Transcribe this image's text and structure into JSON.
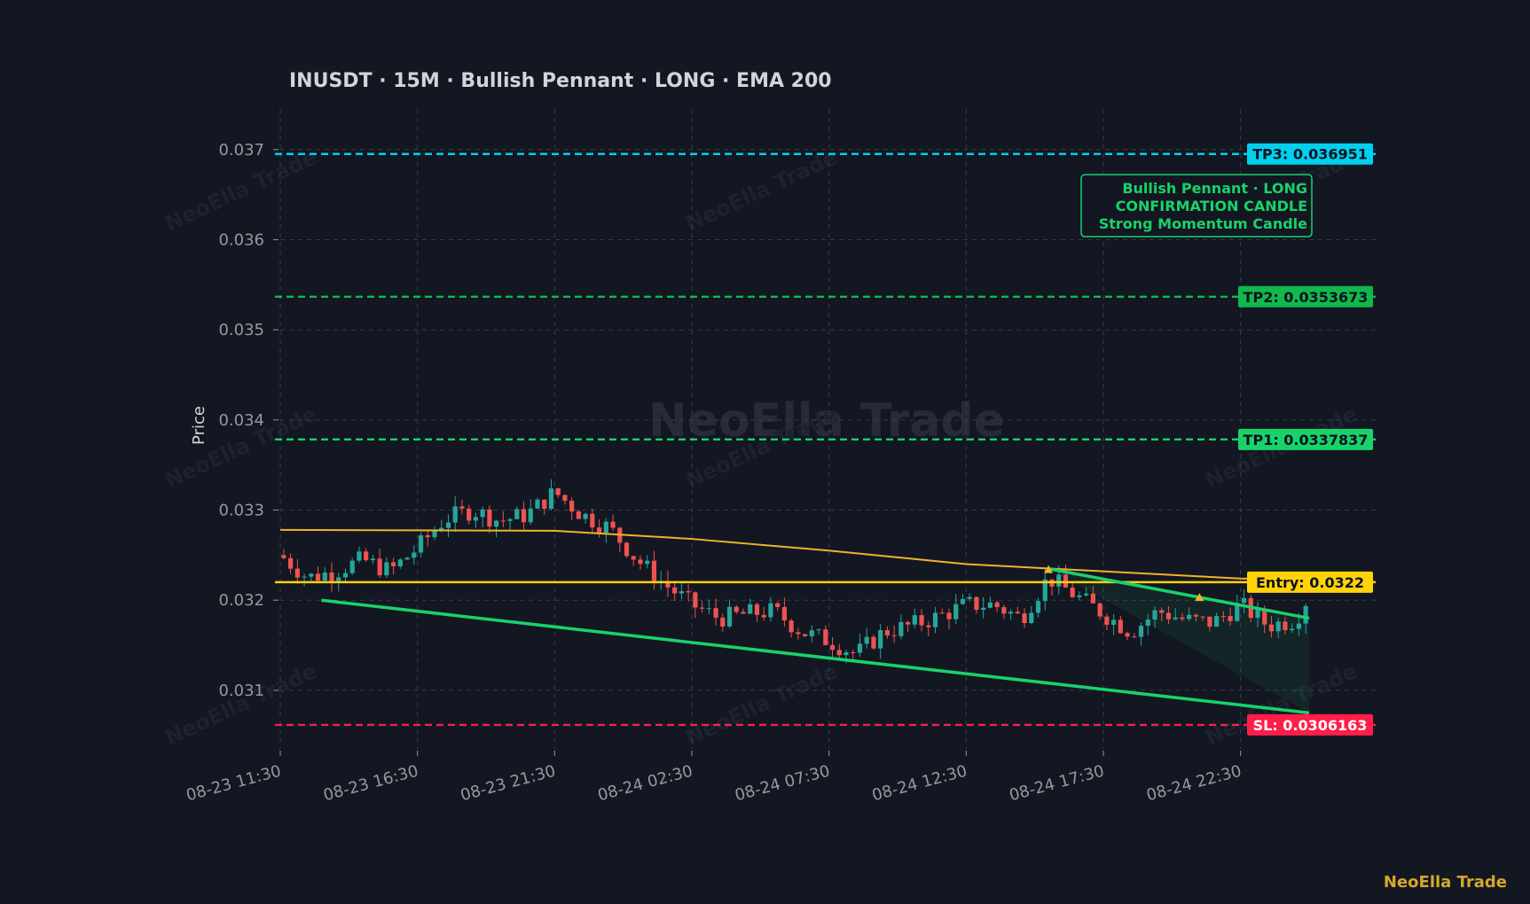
{
  "chart_data": {
    "type": "candlestick",
    "title": "INUSDT  ·  15M  ·  Bullish Pennant  ·  LONG  ·  EMA 200",
    "ylabel": "Price",
    "xlabel": "",
    "ylim": [
      0.03035,
      0.03745
    ],
    "grid": true,
    "y_ticks": [
      "0.031",
      "0.032",
      "0.033",
      "0.034",
      "0.035",
      "0.036",
      "0.037"
    ],
    "x_ticks": [
      "08-23 11:30",
      "08-23 16:30",
      "08-23 21:30",
      "08-24 02:30",
      "08-24 07:30",
      "08-24 12:30",
      "08-24 17:30",
      "08-24 22:30"
    ],
    "x_ticks_bar_index": [
      0,
      20,
      40,
      60,
      80,
      100,
      120,
      140
    ],
    "bars": {
      "count": 150,
      "interval": "15M",
      "first": "08-23 11:30"
    },
    "close_path": [
      [
        0,
        0.0325
      ],
      [
        4,
        0.03225
      ],
      [
        8,
        0.03232
      ],
      [
        12,
        0.03245
      ],
      [
        16,
        0.03232
      ],
      [
        20,
        0.03258
      ],
      [
        24,
        0.0329
      ],
      [
        28,
        0.033
      ],
      [
        32,
        0.03288
      ],
      [
        36,
        0.03295
      ],
      [
        40,
        0.0332
      ],
      [
        44,
        0.03295
      ],
      [
        48,
        0.0328
      ],
      [
        52,
        0.03245
      ],
      [
        56,
        0.03218
      ],
      [
        60,
        0.03195
      ],
      [
        64,
        0.0318
      ],
      [
        68,
        0.03185
      ],
      [
        72,
        0.03188
      ],
      [
        76,
        0.03165
      ],
      [
        80,
        0.03155
      ],
      [
        84,
        0.0314
      ],
      [
        88,
        0.03165
      ],
      [
        92,
        0.03172
      ],
      [
        96,
        0.03182
      ],
      [
        100,
        0.03195
      ],
      [
        104,
        0.03195
      ],
      [
        108,
        0.0318
      ],
      [
        112,
        0.03225
      ],
      [
        116,
        0.03205
      ],
      [
        120,
        0.03185
      ],
      [
        124,
        0.03165
      ],
      [
        128,
        0.03188
      ],
      [
        132,
        0.03178
      ],
      [
        136,
        0.03175
      ],
      [
        140,
        0.03195
      ],
      [
        144,
        0.03172
      ],
      [
        148,
        0.03178
      ],
      [
        150,
        0.03206
      ]
    ],
    "ema200": {
      "name": "EMA 200",
      "points": [
        [
          0,
          0.03278
        ],
        [
          40,
          0.03277
        ],
        [
          60,
          0.03268
        ],
        [
          80,
          0.03255
        ],
        [
          100,
          0.0324
        ],
        [
          120,
          0.03232
        ],
        [
          140,
          0.03224
        ],
        [
          150,
          0.03222
        ]
      ]
    },
    "levels": [
      {
        "label": "TP3: 0.036951",
        "value": 0.036951,
        "color": "#00d0ee",
        "text_color": "#0b1220"
      },
      {
        "label": "TP2: 0.0353673",
        "value": 0.0353673,
        "color": "#10b94b",
        "text_color": "#0b1220"
      },
      {
        "label": "TP1: 0.0337837",
        "value": 0.0337837,
        "color": "#19d26a",
        "text_color": "#0b1220"
      },
      {
        "label": "Entry: 0.0322",
        "value": 0.0322,
        "color": "#ffd20a",
        "text_color": "#0b1220"
      },
      {
        "label": "SL: 0.0306163",
        "value": 0.0306163,
        "color": "#ff1d4a",
        "text_color": "#ffffff"
      }
    ],
    "trendlines": [
      {
        "from": [
          6,
          0.032
        ],
        "to": [
          150,
          0.03075
        ]
      },
      {
        "from": [
          112,
          0.03235
        ],
        "to": [
          150,
          0.0318
        ]
      }
    ],
    "pattern_markers": [
      [
        112,
        0.03234
      ],
      [
        134,
        0.03203
      ]
    ],
    "annotation": {
      "lines": [
        "Bullish Pennant · LONG",
        "CONFIRMATION CANDLE",
        "Strong Momentum Candle"
      ],
      "color": "#19d26a"
    },
    "watermark": "NeoElla Trade"
  },
  "brand": "NeoElla Trade",
  "colors": {
    "background": "#131722",
    "grid": "#363c4e",
    "up": "#26a69a",
    "down": "#ef5350",
    "ema": "#f0b429",
    "trendline": "#19d26a",
    "text": "#d1d4dc",
    "tick": "#9598a1"
  }
}
